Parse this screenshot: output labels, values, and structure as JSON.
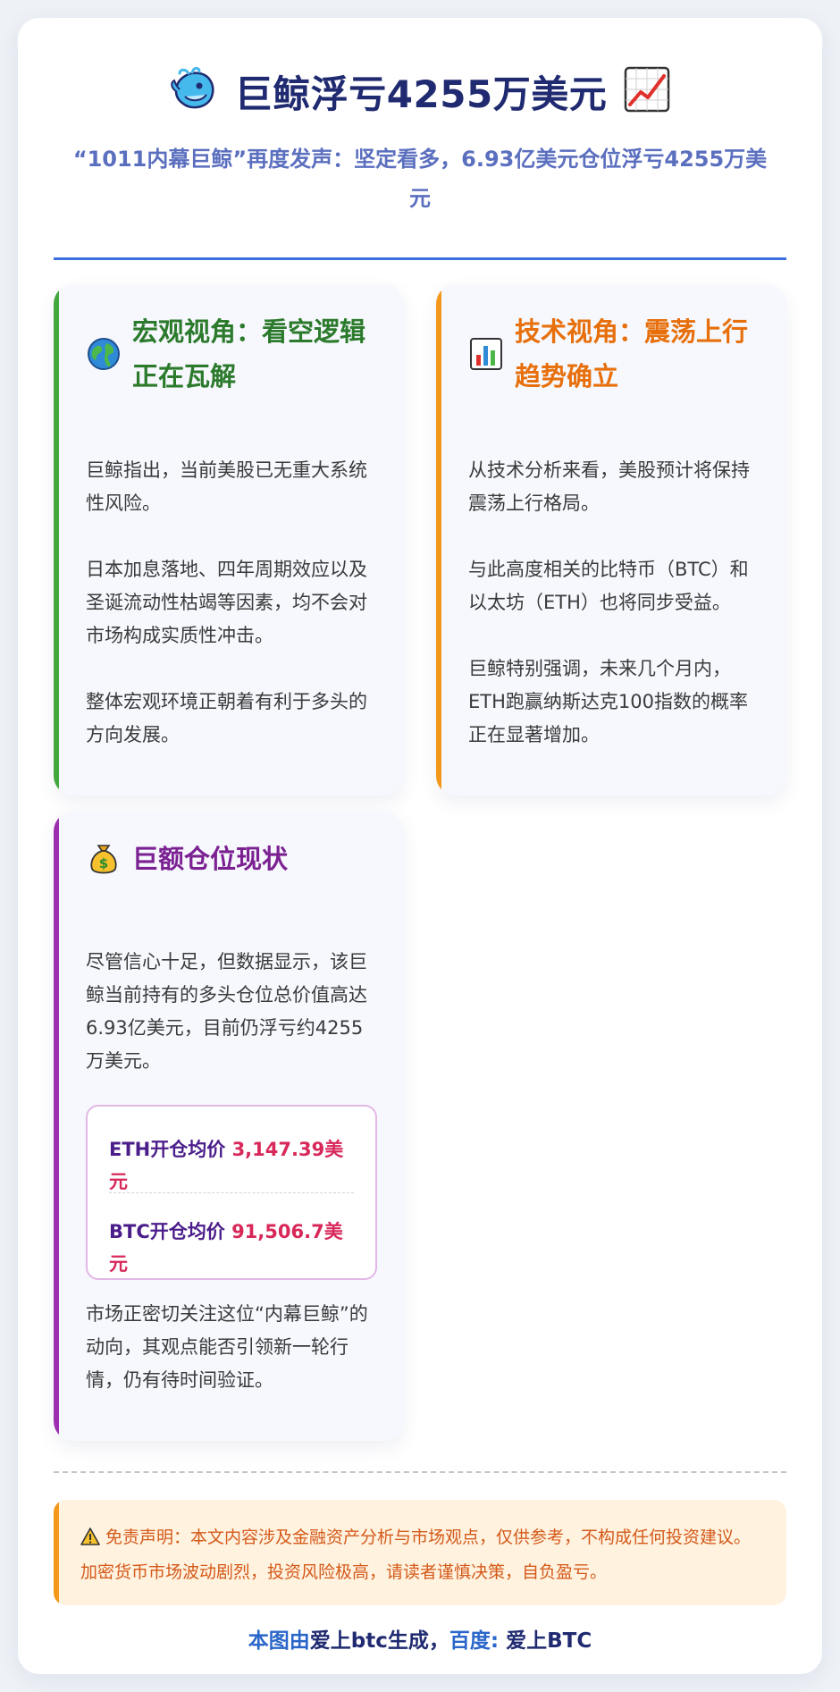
{
  "header": {
    "title": "巨鲸浮亏4255万美元",
    "title_icon_left": "whale-icon",
    "title_icon_right": "chart-increasing-icon",
    "subtitle": "“1011内幕巨鲸”再度发声：坚定看多，6.93亿美元仓位浮亏4255万美元"
  },
  "cards": {
    "macro": {
      "icon": "globe-icon",
      "title": "宏观视角：看空逻辑正在瓦解",
      "paragraphs": [
        "巨鲸指出，当前美股已无重大系统性风险。",
        "日本加息落地、四年周期效应以及圣诞流动性枯竭等因素，均不会对市场构成实质性冲击。",
        "整体宏观环境正朝着有利于多头的方向发展。"
      ]
    },
    "technical": {
      "icon": "bar-chart-icon",
      "title": "技术视角：震荡上行趋势确立",
      "paragraphs": [
        "从技术分析来看，美股预计将保持震荡上行格局。",
        "与此高度相关的比特币（BTC）和以太坊（ETH）也将同步受益。",
        "巨鲸特别强调，未来几个月内，ETH跑赢纳斯达克100指数的概率正在显著增加。"
      ]
    },
    "position": {
      "icon": "money-bag-icon",
      "title": "巨额仓位现状",
      "paragraph_1": "尽管信心十足，但数据显示，该巨鲸当前持有的多头仓位总价值高达6.93亿美元，目前仍浮亏约4255万美元。",
      "prices": [
        {
          "label": "ETH开仓均价",
          "value": "3,147.39美元"
        },
        {
          "label": "BTC开仓均价",
          "value": "91,506.7美元"
        }
      ],
      "paragraph_2": "市场正密切关注这位“内幕巨鲸”的动向，其观点能否引领新一轮行情，仍有待时间验证。"
    }
  },
  "disclaimer": {
    "icon": "warning-icon",
    "text": "免责声明：本文内容涉及金融资产分析与市场观点，仅供参考，不构成任何投资建议。加密货币市场波动剧烈，投资风险极高，请读者谨慎决策，自负盈亏。"
  },
  "footer": {
    "part1": "本图由",
    "part2": "爱上btc生成，",
    "part3": "百度: ",
    "part4": "爱上BTC"
  },
  "colors": {
    "title": "#1f2a70",
    "subtitle": "#5b6fbf",
    "accent_blue": "#3a6fe0",
    "green": "#43a83b",
    "orange": "#f4981b",
    "purple": "#9c2fb0",
    "price_value": "#d8285a"
  }
}
